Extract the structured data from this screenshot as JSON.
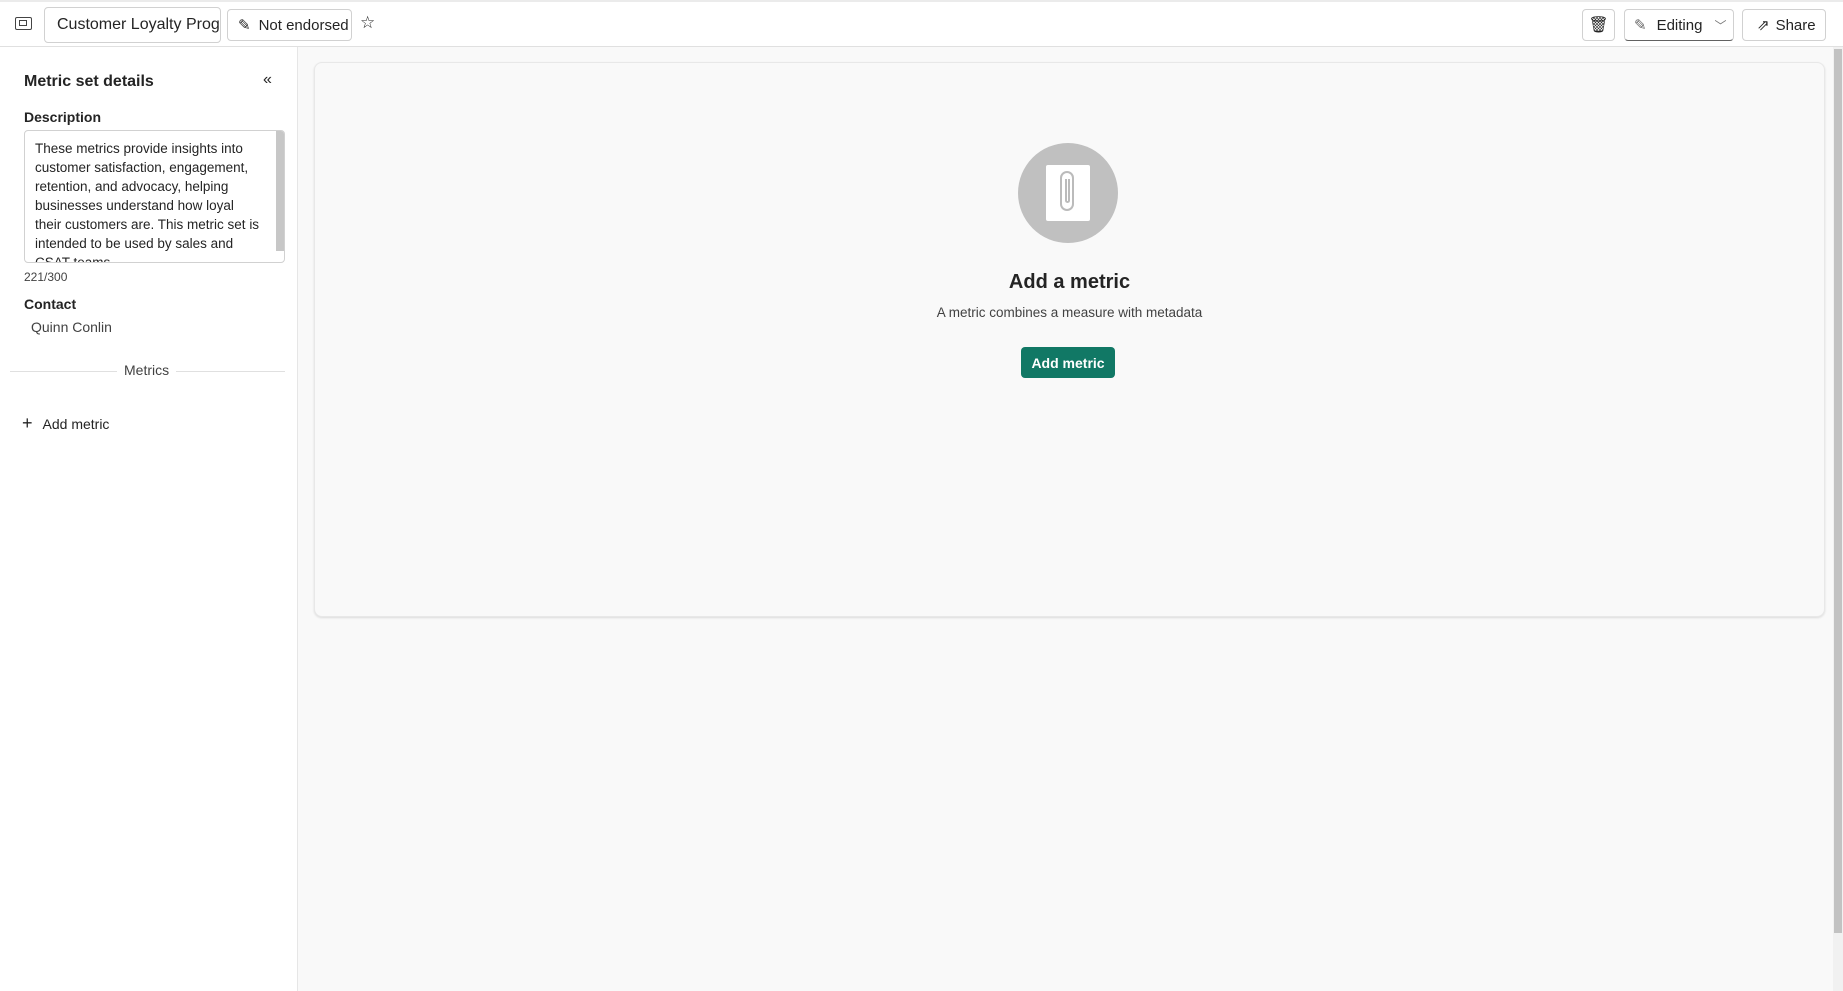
{
  "topbar": {
    "title": "Customer Loyalty Prog",
    "endorsement": "Not endorsed",
    "mode": "Editing",
    "share": "Share"
  },
  "sidebar": {
    "heading": "Metric set details",
    "description_label": "Description",
    "description": "These metrics provide insights into customer satisfaction, engagement, retention, and advocacy, helping businesses understand how loyal their customers are.  This metric set is intended to be used by sales and CSAT teams.",
    "char_count": "221/300",
    "contact_label": "Contact",
    "contact": "Quinn Conlin",
    "metrics_divider": "Metrics",
    "add_metric": "Add metric"
  },
  "main": {
    "empty_title": "Add a metric",
    "empty_subtitle": "A metric combines a measure with metadata",
    "add_button": "Add metric"
  },
  "colors": {
    "accent": "#117865"
  }
}
